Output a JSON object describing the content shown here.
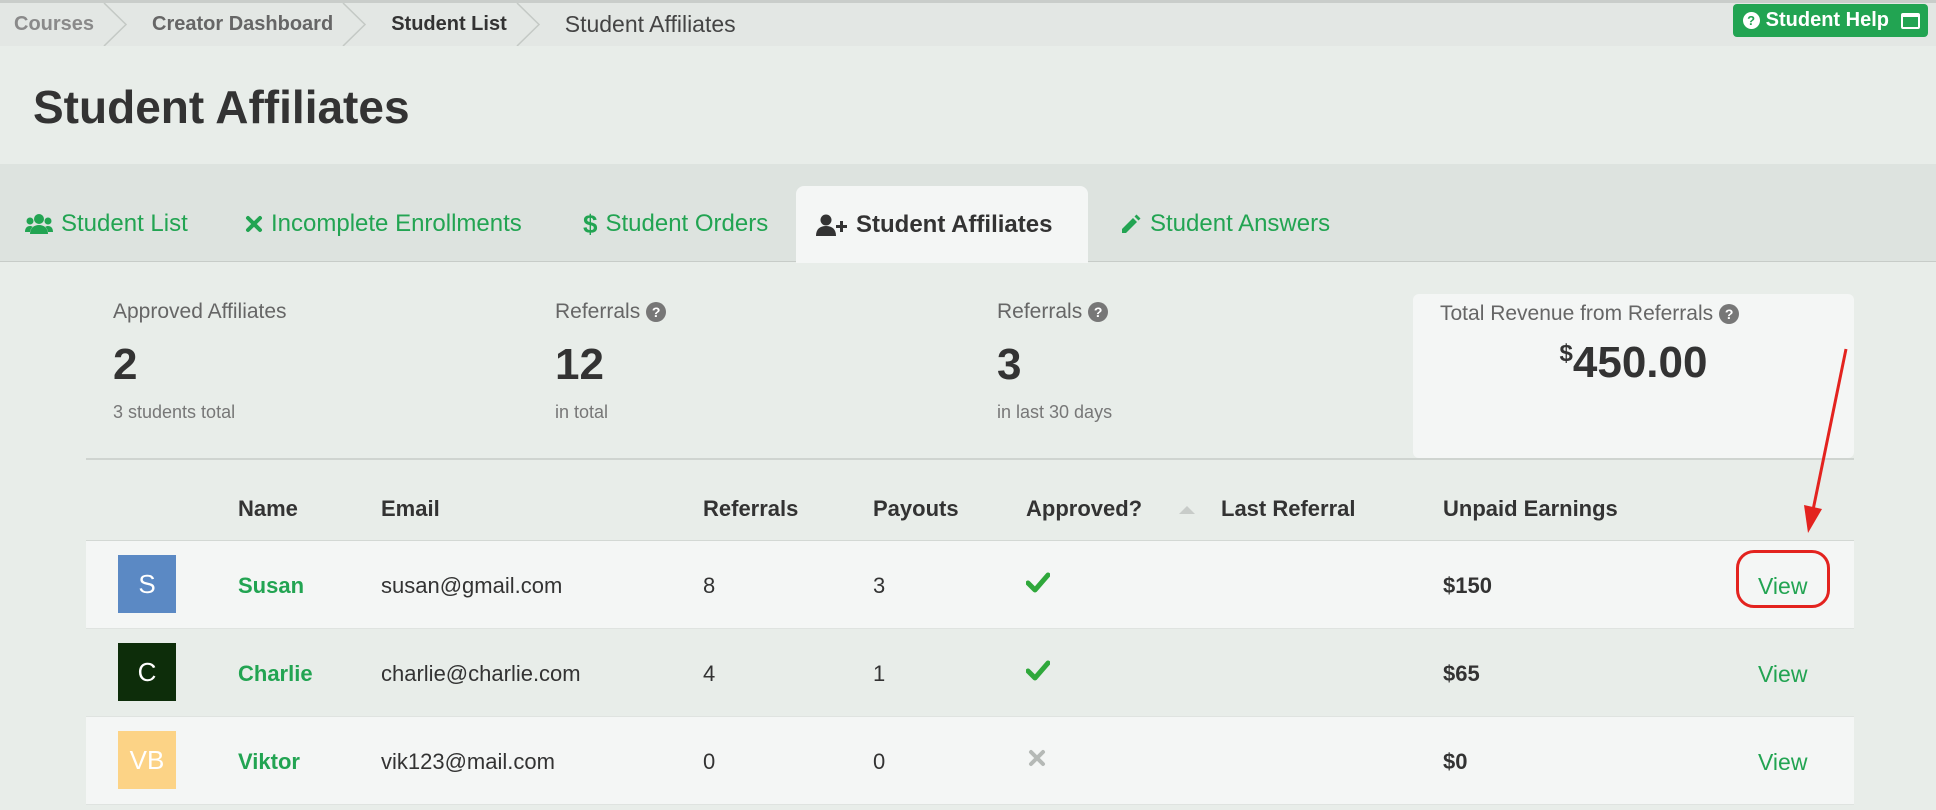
{
  "breadcrumb": {
    "items": [
      "Courses",
      "Creator Dashboard",
      "Student List"
    ],
    "current": "Student Affiliates"
  },
  "help_button": {
    "label": "Student Help"
  },
  "page_title": "Student Affiliates",
  "tabs": [
    {
      "label": "Student List",
      "icon": "users-icon"
    },
    {
      "label": "Incomplete Enrollments",
      "icon": "x-icon"
    },
    {
      "label": "Student Orders",
      "icon": "dollar-icon"
    },
    {
      "label": "Student Affiliates",
      "icon": "user-plus-icon",
      "active": true
    },
    {
      "label": "Student Answers",
      "icon": "pencil-icon"
    }
  ],
  "stats": {
    "approved": {
      "label": "Approved Affiliates",
      "value": "2",
      "sub": "3 students total"
    },
    "referrals_total": {
      "label": "Referrals",
      "value": "12",
      "sub": "in total"
    },
    "referrals_30": {
      "label": "Referrals",
      "value": "3",
      "sub": "in last 30 days"
    },
    "revenue": {
      "label": "Total Revenue from Referrals",
      "currency": "$",
      "value": "450.00"
    }
  },
  "table": {
    "headers": {
      "name": "Name",
      "email": "Email",
      "referrals": "Referrals",
      "payouts": "Payouts",
      "approved": "Approved?",
      "last_referral": "Last Referral",
      "unpaid": "Unpaid Earnings"
    },
    "rows": [
      {
        "initials": "S",
        "avatar_color": "#5b89c4",
        "name": "Susan",
        "email": "susan@gmail.com",
        "referrals": "8",
        "payouts": "3",
        "approved": true,
        "last_referral": "",
        "unpaid": "$150",
        "action": "View"
      },
      {
        "initials": "C",
        "avatar_color": "#0d2d0a",
        "name": "Charlie",
        "email": "charlie@charlie.com",
        "referrals": "4",
        "payouts": "1",
        "approved": true,
        "last_referral": "",
        "unpaid": "$65",
        "action": "View"
      },
      {
        "initials": "VB",
        "avatar_color": "#fcd386",
        "name": "Viktor",
        "email": "vik123@mail.com",
        "referrals": "0",
        "payouts": "0",
        "approved": false,
        "last_referral": "",
        "unpaid": "$0",
        "action": "View"
      }
    ]
  },
  "colors": {
    "accent_green": "#22a452",
    "annotation_red": "#e3231f"
  }
}
